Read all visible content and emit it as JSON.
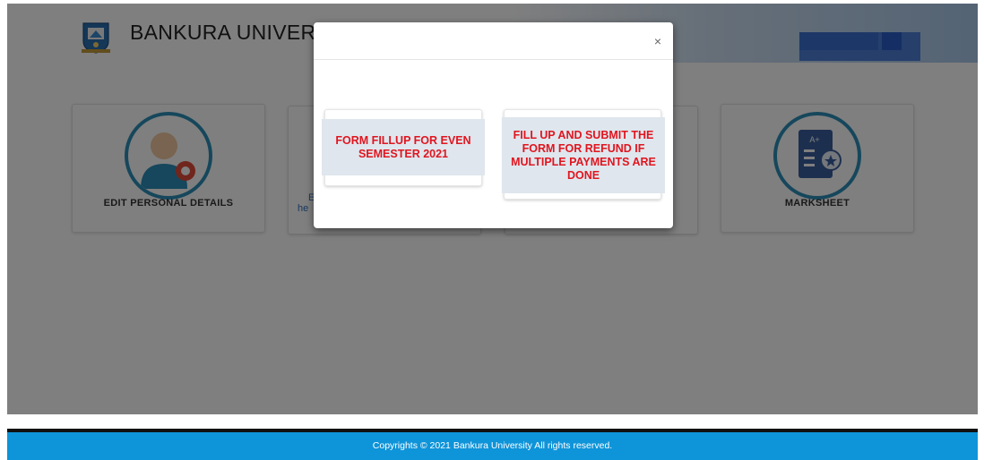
{
  "header": {
    "university_name": "BANKURA UNIVERS",
    "logo_icon": "university-crest-icon"
  },
  "cards": [
    {
      "label": "EDIT PERSONAL DETAILS",
      "icon": "edit-user-icon"
    },
    {
      "partial_text_line1": "E",
      "partial_text_line2": "he"
    },
    {
      "label": ""
    },
    {
      "label": "MARKSHEET",
      "icon": "marksheet-icon"
    }
  ],
  "modal": {
    "close_glyph": "×",
    "options": [
      {
        "label": "FORM FILLUP FOR EVEN SEMESTER 2021"
      },
      {
        "label": "FILL UP AND SUBMIT THE FORM FOR REFUND IF MULTIPLE PAYMENTS ARE DONE"
      }
    ]
  },
  "footer": {
    "copyright": "Copyrights © 2021 Bankura University All rights reserved."
  },
  "colors": {
    "accent": "#2d8fb8",
    "option_text": "#e0151f",
    "footer_bg": "#0e94d9"
  }
}
